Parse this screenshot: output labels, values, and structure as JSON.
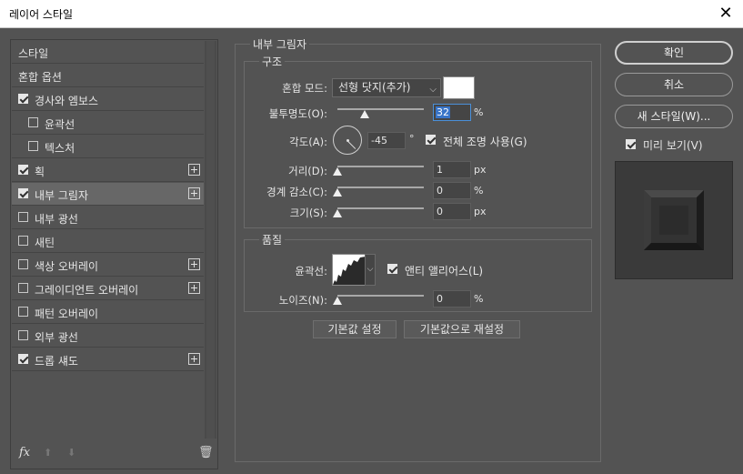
{
  "window": {
    "title": "레이어 스타일",
    "close_glyph": "✕"
  },
  "left_panel": {
    "items": [
      {
        "label": "스타일",
        "checkbox": false,
        "checked": false,
        "plus": false,
        "selected": false,
        "indent": false
      },
      {
        "label": "혼합 옵션",
        "checkbox": false,
        "checked": false,
        "plus": false,
        "selected": false,
        "indent": false
      },
      {
        "label": "경사와 엠보스",
        "checkbox": true,
        "checked": true,
        "plus": false,
        "selected": false,
        "indent": false
      },
      {
        "label": "윤곽선",
        "checkbox": true,
        "checked": false,
        "plus": false,
        "selected": false,
        "indent": true
      },
      {
        "label": "텍스처",
        "checkbox": true,
        "checked": false,
        "plus": false,
        "selected": false,
        "indent": true
      },
      {
        "label": "획",
        "checkbox": true,
        "checked": true,
        "plus": true,
        "selected": false,
        "indent": false
      },
      {
        "label": "내부 그림자",
        "checkbox": true,
        "checked": true,
        "plus": true,
        "selected": true,
        "indent": false
      },
      {
        "label": "내부 광선",
        "checkbox": true,
        "checked": false,
        "plus": false,
        "selected": false,
        "indent": false
      },
      {
        "label": "새틴",
        "checkbox": true,
        "checked": false,
        "plus": false,
        "selected": false,
        "indent": false
      },
      {
        "label": "색상 오버레이",
        "checkbox": true,
        "checked": false,
        "plus": true,
        "selected": false,
        "indent": false
      },
      {
        "label": "그레이디언트 오버레이",
        "checkbox": true,
        "checked": false,
        "plus": true,
        "selected": false,
        "indent": false
      },
      {
        "label": "패턴 오버레이",
        "checkbox": true,
        "checked": false,
        "plus": false,
        "selected": false,
        "indent": false
      },
      {
        "label": "외부 광선",
        "checkbox": true,
        "checked": false,
        "plus": false,
        "selected": false,
        "indent": false
      },
      {
        "label": "드롭 섀도",
        "checkbox": true,
        "checked": true,
        "plus": true,
        "selected": false,
        "indent": false
      }
    ],
    "footer": {
      "fx_label": "fx",
      "up_glyph": "⬆",
      "down_glyph": "⬇",
      "trash_glyph": "🗑"
    }
  },
  "inner_shadow": {
    "section_title": "내부 그림자",
    "structure": {
      "title": "구조",
      "blend_mode_label": "혼합 모드:",
      "blend_mode_value": "선형 닷지(추가)",
      "blend_color": "#ffffff",
      "opacity_label": "불투명도(O):",
      "opacity_value": "32",
      "opacity_unit": "%",
      "opacity_fraction": 0.32,
      "angle_label": "각도(A):",
      "angle_value": "-45",
      "angle_unit": "°",
      "global_light_label": "전체 조명 사용(G)",
      "global_light_checked": true,
      "distance_label": "거리(D):",
      "distance_value": "1",
      "distance_unit": "px",
      "choke_label": "경계 감소(C):",
      "choke_value": "0",
      "choke_unit": "%",
      "size_label": "크기(S):",
      "size_value": "0",
      "size_unit": "px"
    },
    "quality": {
      "title": "품질",
      "contour_label": "윤곽선:",
      "antialias_label": "앤티 앨리어스(L)",
      "antialias_checked": true,
      "noise_label": "노이즈(N):",
      "noise_value": "0",
      "noise_unit": "%"
    },
    "make_default_label": "기본값 설정",
    "reset_default_label": "기본값으로 재설정"
  },
  "right_panel": {
    "ok_label": "확인",
    "cancel_label": "취소",
    "new_style_label": "새 스타일(W)...",
    "preview_label": "미리 보기(V)",
    "preview_checked": true
  }
}
